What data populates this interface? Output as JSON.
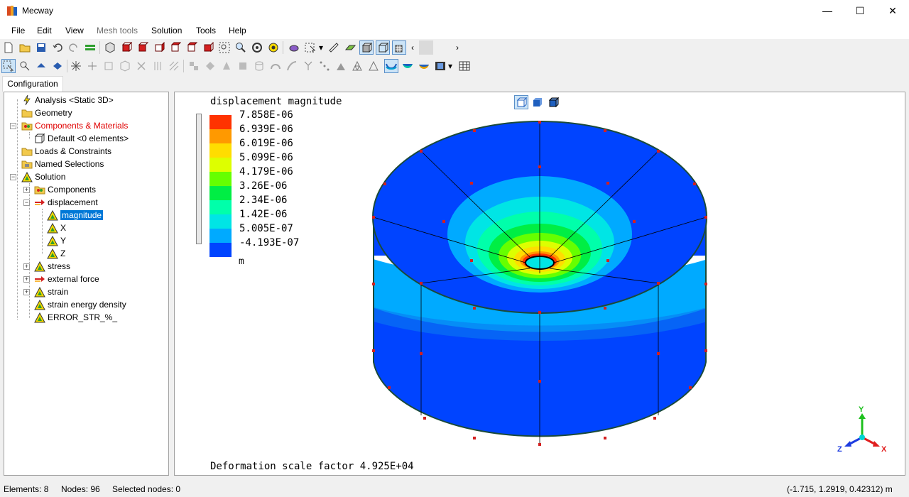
{
  "window": {
    "title": "Mecway",
    "minimize": "—",
    "maximize": "☐",
    "close": "✕"
  },
  "menu": {
    "file": "File",
    "edit": "Edit",
    "view": "View",
    "mesh_tools": "Mesh tools",
    "solution": "Solution",
    "tools": "Tools",
    "help": "Help"
  },
  "tabs": {
    "configuration": "Configuration"
  },
  "tree": {
    "analysis": "Analysis <Static 3D>",
    "geometry": "Geometry",
    "components_materials": "Components & Materials",
    "default": "Default <0 elements>",
    "loads": "Loads & Constraints",
    "named_selections": "Named Selections",
    "solution": "Solution",
    "components": "Components",
    "displacement": "displacement",
    "magnitude": "magnitude",
    "x": "X",
    "y": "Y",
    "z": "Z",
    "stress": "stress",
    "external_force": "external force",
    "strain": "strain",
    "strain_energy_density": "strain energy density",
    "error_str": "ERROR_STR_%_"
  },
  "legend": {
    "title": "displacement magnitude",
    "unit": "m",
    "values": [
      "7.858E-06",
      "6.939E-06",
      "6.019E-06",
      "5.099E-06",
      "4.179E-06",
      "3.26E-06",
      "2.34E-06",
      "1.42E-06",
      "5.005E-07",
      "-4.193E-07"
    ],
    "colors": [
      "#ff3300",
      "#ff9900",
      "#ffdd00",
      "#ddff00",
      "#66ff00",
      "#00ee44",
      "#00ffaa",
      "#00e5e5",
      "#00aaff",
      "#0044ff"
    ]
  },
  "viewport": {
    "deformation": "Deformation scale factor 4.925E+04"
  },
  "triad": {
    "x": "X",
    "y": "Y",
    "z": "Z"
  },
  "status": {
    "elements": "Elements: 8",
    "nodes": "Nodes: 96",
    "selected_nodes": "Selected nodes: 0",
    "coords": "(-1.715, 1.2919, 0.42312) m"
  }
}
